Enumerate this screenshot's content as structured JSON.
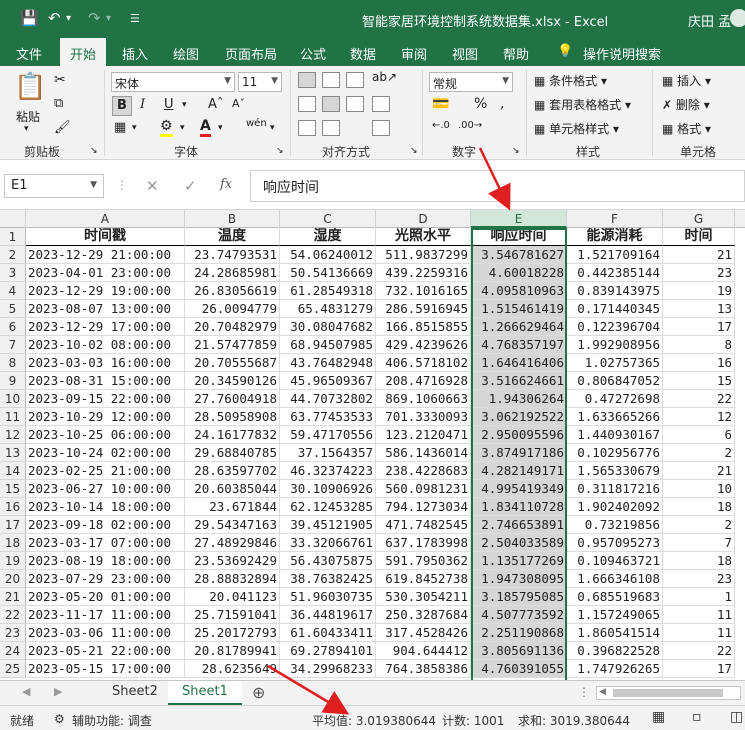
{
  "titlebar": {
    "title": "智能家居环境控制系统数据集.xlsx  -  Excel",
    "user": "庆田 孟"
  },
  "tabs": [
    "文件",
    "开始",
    "插入",
    "绘图",
    "页面布局",
    "公式",
    "数据",
    "审阅",
    "视图",
    "帮助",
    "操作说明搜索"
  ],
  "ribbon": {
    "paste_label": "粘贴",
    "clipboard_label": "剪贴板",
    "font_name": "宋体",
    "font_size": "11",
    "font_label": "字体",
    "align_label": "对齐方式",
    "number_format": "常规",
    "number_label": "数字",
    "cond_format": "条件格式",
    "table_format": "套用表格格式",
    "cell_style": "单元格样式",
    "style_label": "样式",
    "insert": "插入",
    "delete": "删除",
    "format": "格式",
    "cells_label": "单元格",
    "bold": "B",
    "italic": "I",
    "underline": "U",
    "font_color": "A",
    "wen": "wén"
  },
  "formula_bar": {
    "name_box": "E1",
    "fx": "fx",
    "content": "响应时间"
  },
  "sheet": {
    "columns": [
      "A",
      "B",
      "C",
      "D",
      "E",
      "F",
      "G"
    ],
    "header": [
      "时间戳",
      "温度",
      "湿度",
      "光照水平",
      "响应时间",
      "能源消耗",
      "时间"
    ],
    "rows": [
      [
        "2023-12-29 21:00:00",
        "23.74793531",
        "54.06240012",
        "511.9837299",
        "3.546781627",
        "1.521709164",
        "21"
      ],
      [
        "2023-04-01 23:00:00",
        "24.28685981",
        "50.54136669",
        "439.2259316",
        "4.60018228",
        "0.442385144",
        "23"
      ],
      [
        "2023-12-29 19:00:00",
        "26.83056619",
        "61.28549318",
        "732.1016165",
        "4.095810963",
        "0.839143975",
        "19"
      ],
      [
        "2023-08-07 13:00:00",
        "26.0094779",
        "65.4831279",
        "286.5916945",
        "1.515461419",
        "0.171440345",
        "13"
      ],
      [
        "2023-12-29 17:00:00",
        "20.70482979",
        "30.08047682",
        "166.8515855",
        "1.266629464",
        "0.122396704",
        "17"
      ],
      [
        "2023-10-02 08:00:00",
        "21.57477859",
        "68.94507985",
        "429.4239626",
        "4.768357197",
        "1.992908956",
        "8"
      ],
      [
        "2023-03-03 16:00:00",
        "20.70555687",
        "43.76482948",
        "406.5718102",
        "1.646416406",
        "1.02757365",
        "16"
      ],
      [
        "2023-08-31 15:00:00",
        "20.34590126",
        "45.96509367",
        "208.4716928",
        "3.516624661",
        "0.806847052",
        "15"
      ],
      [
        "2023-09-15 22:00:00",
        "27.76004918",
        "44.70732802",
        "869.1060663",
        "1.94306264",
        "0.47272698",
        "22"
      ],
      [
        "2023-10-29 12:00:00",
        "28.50958908",
        "63.77453533",
        "701.3330093",
        "3.062192522",
        "1.633665266",
        "12"
      ],
      [
        "2023-10-25 06:00:00",
        "24.16177832",
        "59.47170556",
        "123.2120471",
        "2.950095596",
        "1.440930167",
        "6"
      ],
      [
        "2023-10-24 02:00:00",
        "29.68840785",
        "37.1564357",
        "586.1436014",
        "3.874917186",
        "0.102956776",
        "2"
      ],
      [
        "2023-02-25 21:00:00",
        "28.63597702",
        "46.32374223",
        "238.4228683",
        "4.282149171",
        "1.565330679",
        "21"
      ],
      [
        "2023-06-27 10:00:00",
        "20.60385044",
        "30.10906926",
        "560.0981231",
        "4.995419349",
        "0.311817216",
        "10"
      ],
      [
        "2023-10-14 18:00:00",
        "23.671844",
        "62.12453285",
        "794.1273034",
        "1.834110728",
        "1.902402092",
        "18"
      ],
      [
        "2023-09-18 02:00:00",
        "29.54347163",
        "39.45121905",
        "471.7482545",
        "2.746653891",
        "0.73219856",
        "2"
      ],
      [
        "2023-03-17 07:00:00",
        "27.48929846",
        "33.32066761",
        "637.1783998",
        "2.504033589",
        "0.957095273",
        "7"
      ],
      [
        "2023-08-19 18:00:00",
        "23.53692429",
        "56.43075875",
        "591.7950362",
        "1.135177269",
        "0.109463721",
        "18"
      ],
      [
        "2023-07-29 23:00:00",
        "28.88832894",
        "38.76382425",
        "619.8452738",
        "1.947308095",
        "1.666346108",
        "23"
      ],
      [
        "2023-05-20 01:00:00",
        "20.041123",
        "51.96030735",
        "530.3054211",
        "3.185795085",
        "0.685519683",
        "1"
      ],
      [
        "2023-11-17 11:00:00",
        "25.71591041",
        "36.44819617",
        "250.3287684",
        "4.507773592",
        "1.157249065",
        "11"
      ],
      [
        "2023-03-06 11:00:00",
        "25.20172793",
        "61.60433411",
        "317.4528426",
        "2.251190868",
        "1.860541514",
        "11"
      ],
      [
        "2023-05-21 22:00:00",
        "20.81789941",
        "69.27894101",
        "904.644412",
        "3.805691136",
        "0.396822528",
        "22"
      ],
      [
        "2023-05-15 17:00:00",
        "28.6235649",
        "34.29968233",
        "764.3858386",
        "4.760391055",
        "1.747926265",
        "17"
      ]
    ]
  },
  "sheet_tabs": [
    "Sheet2",
    "Sheet1"
  ],
  "status": {
    "ready": "就绪",
    "accessibility": "辅助功能: 调查",
    "average": "平均值: 3.019380644",
    "count": "计数: 1001",
    "sum": "求和: 3019.380644"
  },
  "colors": {
    "accent": "#217346",
    "arrow": "#e02020"
  }
}
